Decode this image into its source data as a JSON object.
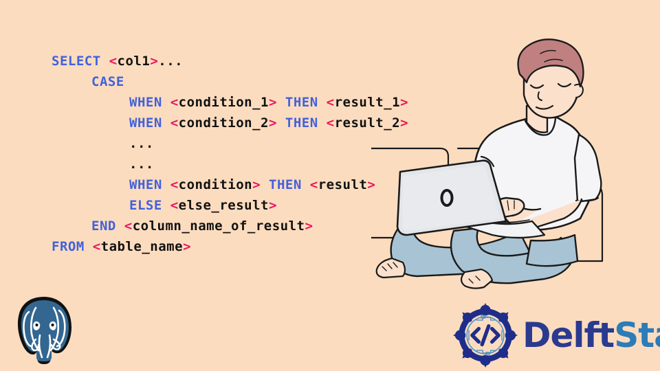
{
  "background_color": "#FCDCBF",
  "colors": {
    "keyword": "#4261DC",
    "bracket": "#E8175D",
    "identifier": "#111111",
    "postgres_blue": "#336791",
    "delft_navy": "#2A3A8F",
    "stack_blue": "#2B7CB8",
    "emblem_navy": "#1F2D8A",
    "shirt": "#F5F5F7",
    "jeans": "#A8C3D4",
    "hair": "#C08080",
    "skin": "#FBE0CC",
    "laptop": "#E3E5E8"
  },
  "code": {
    "language": "sql",
    "lines": [
      {
        "indent": 0,
        "tokens": [
          {
            "type": "keyword",
            "text": "SELECT"
          },
          {
            "type": "plain",
            "text": " "
          },
          {
            "type": "bracket",
            "text": "<"
          },
          {
            "type": "identifier",
            "text": "col1"
          },
          {
            "type": "bracket",
            "text": ">"
          },
          {
            "type": "plain",
            "text": "..."
          }
        ]
      },
      {
        "indent": 1,
        "tokens": [
          {
            "type": "keyword",
            "text": "CASE"
          }
        ]
      },
      {
        "indent": 2,
        "tokens": [
          {
            "type": "keyword",
            "text": "WHEN"
          },
          {
            "type": "plain",
            "text": " "
          },
          {
            "type": "bracket",
            "text": "<"
          },
          {
            "type": "identifier",
            "text": "condition_1"
          },
          {
            "type": "bracket",
            "text": ">"
          },
          {
            "type": "plain",
            "text": " "
          },
          {
            "type": "keyword",
            "text": "THEN"
          },
          {
            "type": "plain",
            "text": " "
          },
          {
            "type": "bracket",
            "text": "<"
          },
          {
            "type": "identifier",
            "text": "result_1"
          },
          {
            "type": "bracket",
            "text": ">"
          }
        ]
      },
      {
        "indent": 2,
        "tokens": [
          {
            "type": "keyword",
            "text": "WHEN"
          },
          {
            "type": "plain",
            "text": " "
          },
          {
            "type": "bracket",
            "text": "<"
          },
          {
            "type": "identifier",
            "text": "condition_2"
          },
          {
            "type": "bracket",
            "text": ">"
          },
          {
            "type": "plain",
            "text": " "
          },
          {
            "type": "keyword",
            "text": "THEN"
          },
          {
            "type": "plain",
            "text": " "
          },
          {
            "type": "bracket",
            "text": "<"
          },
          {
            "type": "identifier",
            "text": "result_2"
          },
          {
            "type": "bracket",
            "text": ">"
          }
        ]
      },
      {
        "indent": 2,
        "tokens": [
          {
            "type": "plain",
            "text": "..."
          }
        ]
      },
      {
        "indent": 2,
        "tokens": [
          {
            "type": "plain",
            "text": "..."
          }
        ]
      },
      {
        "indent": 2,
        "tokens": [
          {
            "type": "keyword",
            "text": "WHEN"
          },
          {
            "type": "plain",
            "text": " "
          },
          {
            "type": "bracket",
            "text": "<"
          },
          {
            "type": "identifier",
            "text": "condition"
          },
          {
            "type": "bracket",
            "text": ">"
          },
          {
            "type": "plain",
            "text": " "
          },
          {
            "type": "keyword",
            "text": "THEN"
          },
          {
            "type": "plain",
            "text": " "
          },
          {
            "type": "bracket",
            "text": "<"
          },
          {
            "type": "identifier",
            "text": "result"
          },
          {
            "type": "bracket",
            "text": ">"
          }
        ]
      },
      {
        "indent": 2,
        "tokens": [
          {
            "type": "keyword",
            "text": "ELSE"
          },
          {
            "type": "plain",
            "text": " "
          },
          {
            "type": "bracket",
            "text": "<"
          },
          {
            "type": "identifier",
            "text": "else_result"
          },
          {
            "type": "bracket",
            "text": ">"
          }
        ]
      },
      {
        "indent": 1,
        "tokens": [
          {
            "type": "keyword",
            "text": "END"
          },
          {
            "type": "plain",
            "text": " "
          },
          {
            "type": "bracket",
            "text": "<"
          },
          {
            "type": "identifier",
            "text": "column_name_of_result"
          },
          {
            "type": "bracket",
            "text": ">"
          }
        ]
      },
      {
        "indent": 0,
        "tokens": [
          {
            "type": "keyword",
            "text": "FROM"
          },
          {
            "type": "plain",
            "text": " "
          },
          {
            "type": "bracket",
            "text": "<"
          },
          {
            "type": "identifier",
            "text": "table_name"
          },
          {
            "type": "bracket",
            "text": ">"
          }
        ]
      }
    ]
  },
  "illustration": {
    "name": "man-sitting-cross-legged-with-laptop-on-sofa",
    "laptop_lid_logo": "O"
  },
  "postgres_logo": {
    "name": "postgresql-elephant-logo"
  },
  "delftstack_logo": {
    "emblem_name": "delftstack-code-emblem",
    "emblem_glyph": "</>",
    "word_part_1": "Delft",
    "word_part_2": "Stack"
  }
}
